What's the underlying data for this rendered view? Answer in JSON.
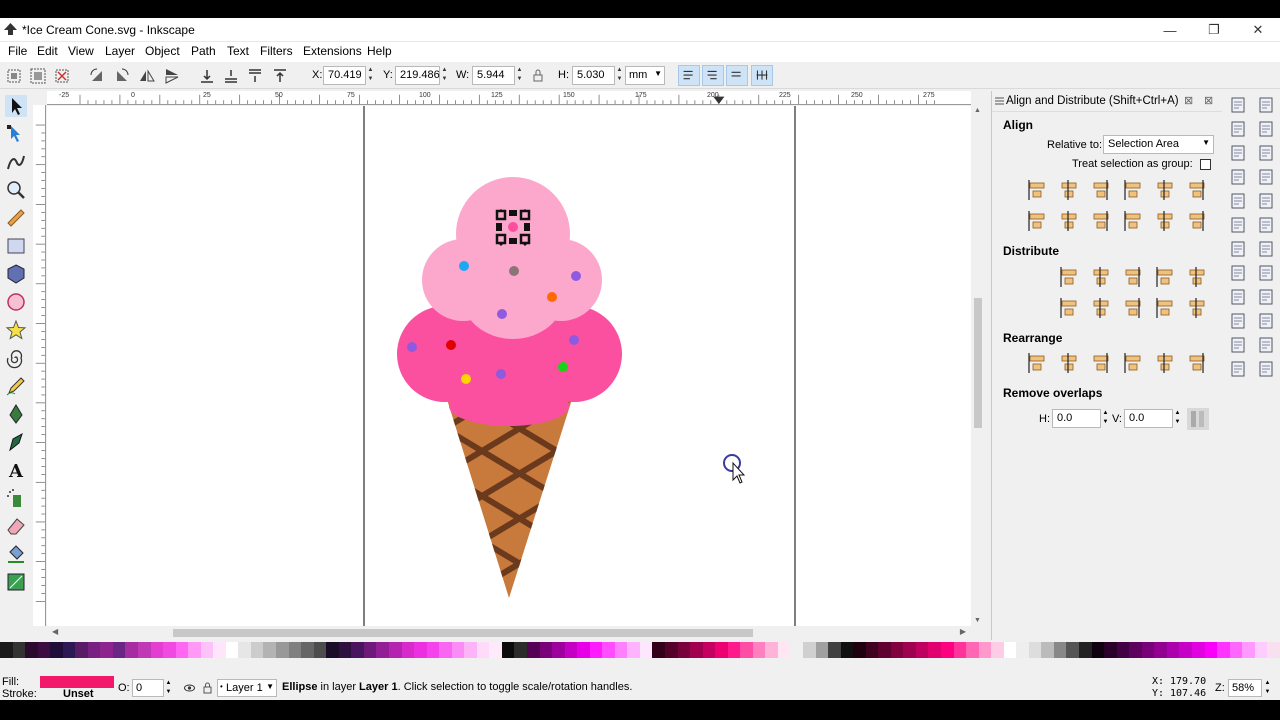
{
  "window": {
    "title": "*Ice Cream Cone.svg - Inkscape",
    "minimize": "—",
    "maximize": "❐",
    "close": "✕"
  },
  "menu": [
    "File",
    "Edit",
    "View",
    "Layer",
    "Object",
    "Path",
    "Text",
    "Filters",
    "Extensions",
    "Help"
  ],
  "toolbar": {
    "x_label": "X:",
    "x_value": "70.419",
    "y_label": "Y:",
    "y_value": "219.486",
    "w_label": "W:",
    "w_value": "5.944",
    "h_label": "H:",
    "h_value": "5.030",
    "unit": "mm",
    "lock_icon": "lock-icon"
  },
  "ruler_labels": [
    "-25",
    "0",
    "25",
    "50",
    "75",
    "100",
    "125",
    "150",
    "175",
    "200",
    "225",
    "250",
    "275"
  ],
  "dock": {
    "title": "Align and Distribute (Shift+Ctrl+A)",
    "align_heading": "Align",
    "relative_to_label": "Relative to:",
    "relative_to_value": "Selection Area",
    "treat_group_label": "Treat selection as group:",
    "distribute_heading": "Distribute",
    "rearrange_heading": "Rearrange",
    "remove_overlaps_heading": "Remove overlaps",
    "h_label": "H:",
    "h_value": "0.0",
    "v_label": "V:",
    "v_value": "0.0"
  },
  "statusbar": {
    "fill_label": "Fill:",
    "stroke_label": "Stroke:",
    "stroke_value": "Unset",
    "fill_color": "#f2196b",
    "opacity_label": "O:",
    "opacity_value": "0",
    "layer": "Layer 1",
    "message_object": "Ellipse",
    "message_mid": " in layer ",
    "message_layer": "Layer 1",
    "message_end": ". Click selection to toggle scale/rotation handles.",
    "cursor_x_label": "X:",
    "cursor_x": "179.70",
    "cursor_y_label": "Y:",
    "cursor_y": "107.46",
    "zoom_label": "Z:",
    "zoom": "58%"
  },
  "colors": {
    "scoop_top": "#fca8cd",
    "scoop_bottom": "#fb4fa0",
    "cone": "#c87a3d",
    "cone_lines": "#6b3a1c",
    "accent": "#d5e6f8"
  },
  "palette": [
    "#1a1a1a",
    "#333",
    "#2b0a2e",
    "#3d0b41",
    "#1f0c3a",
    "#2c1853",
    "#5a1b66",
    "#7a1f82",
    "#8c238f",
    "#6b2585",
    "#a62ca2",
    "#c038b5",
    "#e43dd1",
    "#f04ae2",
    "#ff66f2",
    "#ff99f5",
    "#ffc2f8",
    "#ffe5fb",
    "#fff",
    "#e6e6e6",
    "#ccc",
    "#b3b3b3",
    "#999",
    "#808080",
    "#666",
    "#4d4d4d",
    "#1a0d28",
    "#2d1040",
    "#48155e",
    "#6d1a7a",
    "#921f96",
    "#b524b0",
    "#d829cb",
    "#ec2fe0",
    "#f442ec",
    "#f866f2",
    "#fb8cf5",
    "#fdb3f8",
    "#ffdafb",
    "#ffeafc",
    "#0b0b0b",
    "#2b2b2b",
    "#550055",
    "#7a007a",
    "#9e009e",
    "#c300c3",
    "#e700e7",
    "#ff1aff",
    "#ff4dff",
    "#ff80ff",
    "#ffb3ff",
    "#ffe6ff",
    "#330019",
    "#55002a",
    "#7a003c",
    "#a0004e",
    "#c60060",
    "#ec0072",
    "#ff1a8c",
    "#ff4da6",
    "#ff80bf",
    "#ffb3d9",
    "#ffe6f2",
    "#f0f0f0",
    "#d0d0d0",
    "#a0a0a0",
    "#404040",
    "#101010",
    "#200010",
    "#400020",
    "#600030",
    "#800040",
    "#a00050",
    "#c00060",
    "#e00070",
    "#ff0080",
    "#ff3399",
    "#ff66b3",
    "#ff99cc",
    "#ffcce6",
    "#fff",
    "#eee",
    "#ddd",
    "#bbb",
    "#888",
    "#555",
    "#222",
    "#110011",
    "#2a002a",
    "#440044",
    "#5e005e",
    "#780078",
    "#920092",
    "#ac00ac",
    "#c600c6",
    "#e000e0",
    "#fa00fa",
    "#ff33ff",
    "#ff66ff",
    "#ff99ff",
    "#ffccff",
    "#f8e0f0"
  ]
}
